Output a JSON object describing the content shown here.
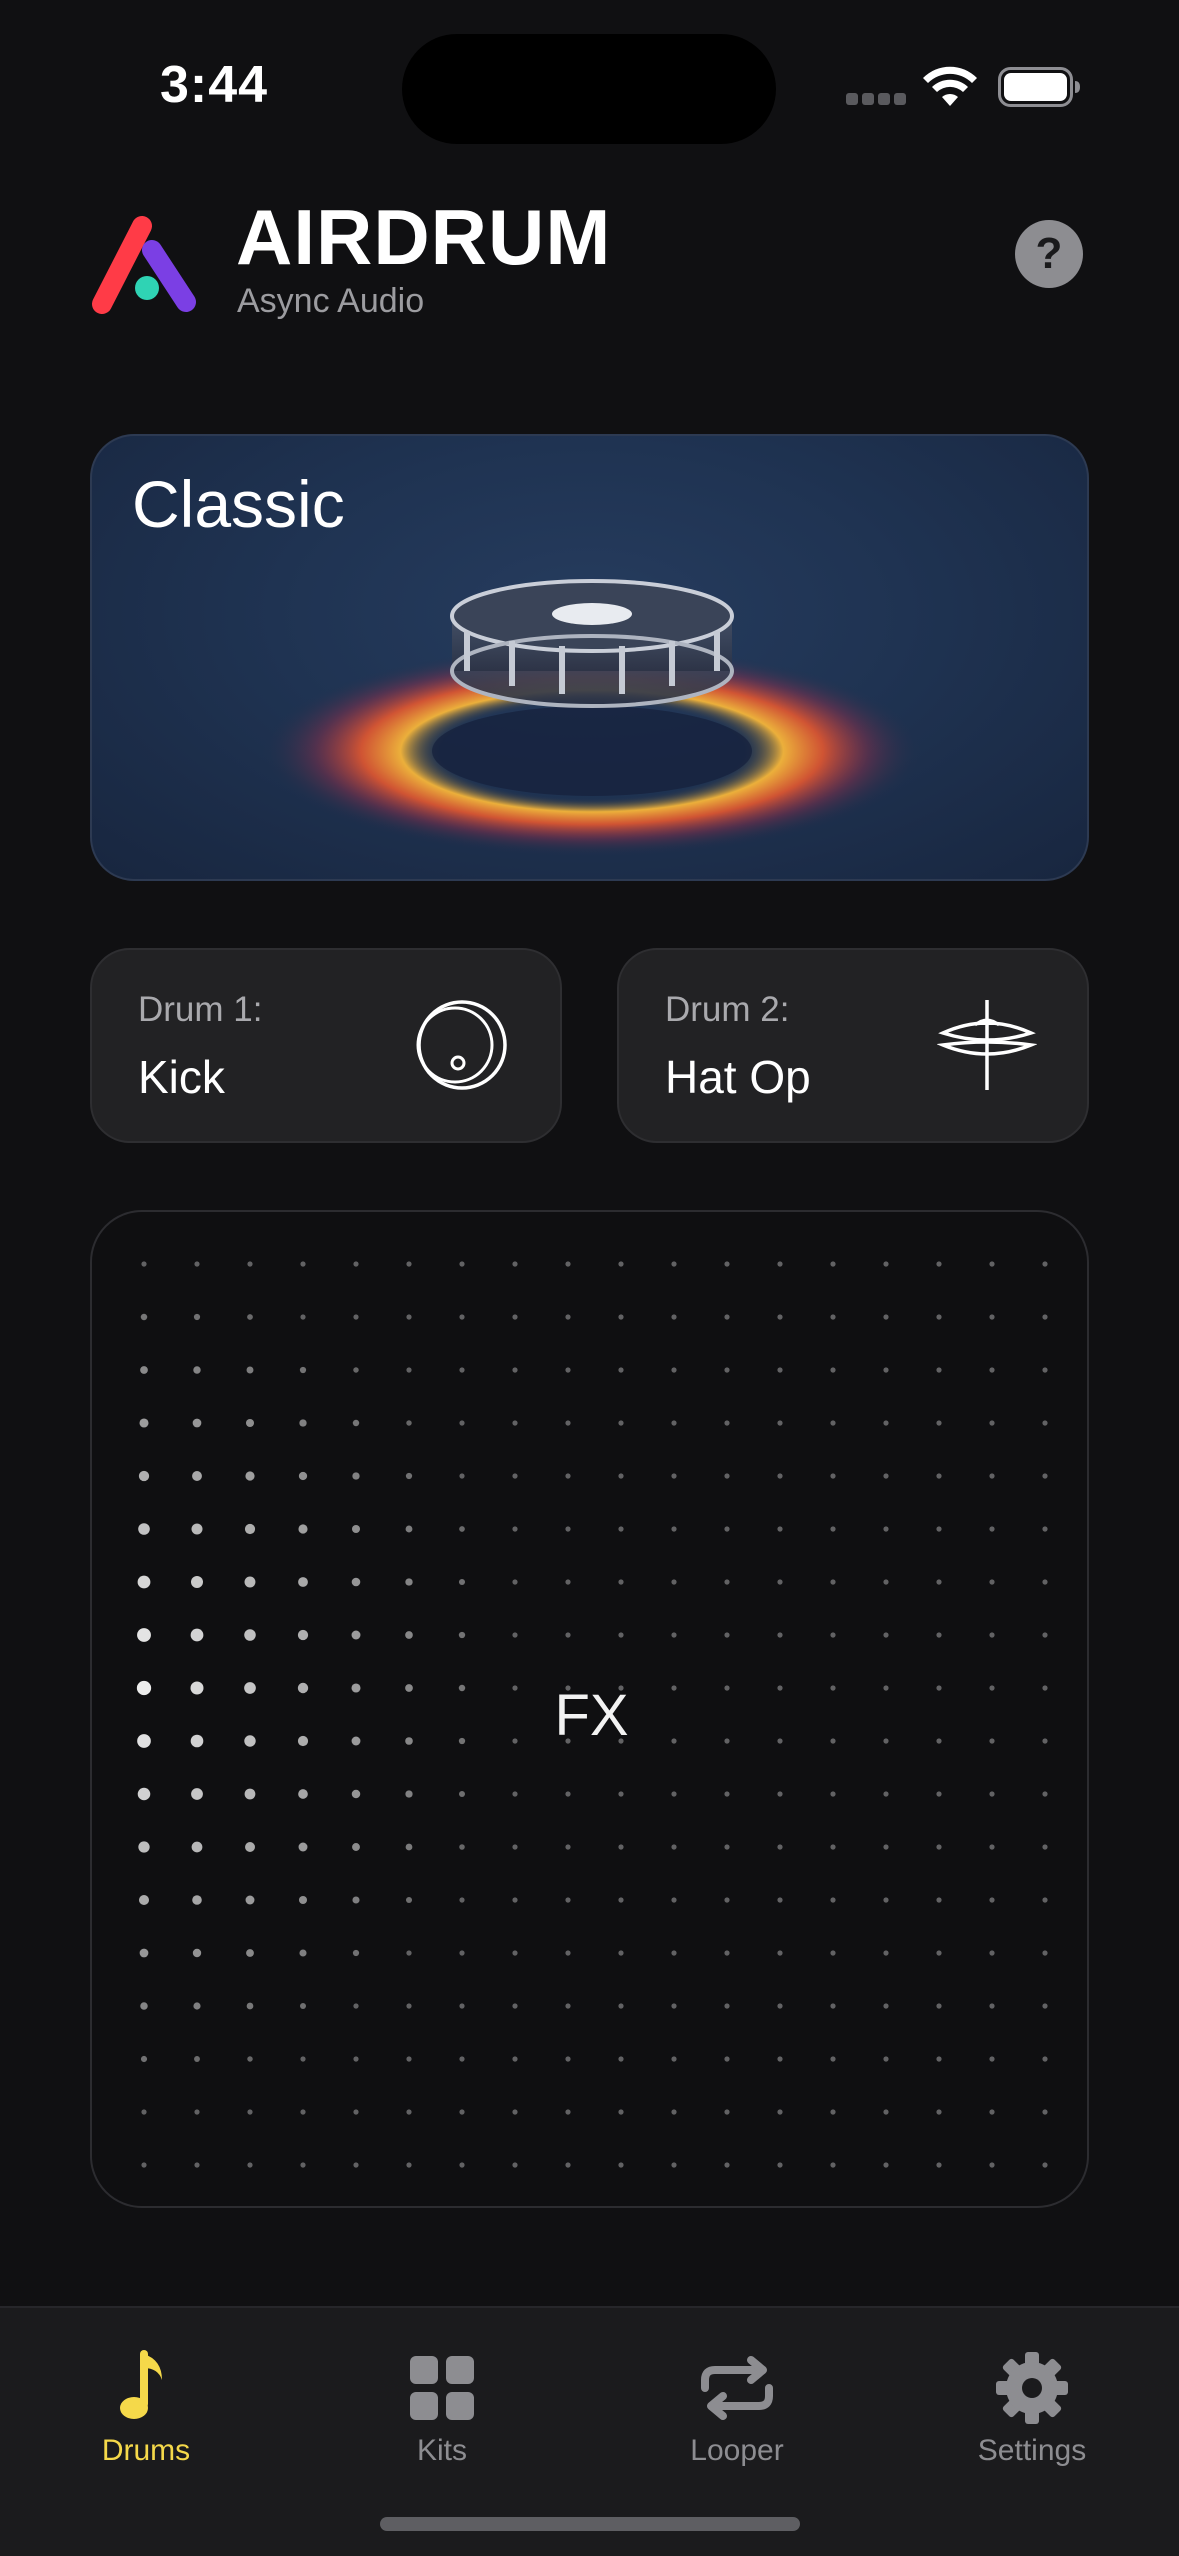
{
  "status_bar": {
    "time": "3:44"
  },
  "header": {
    "brand": "AIRDRUM",
    "subtitle": "Async Audio",
    "help_label": "?"
  },
  "kit": {
    "name": "Classic"
  },
  "drums": [
    {
      "label": "Drum 1:",
      "value": "Kick",
      "icon": "kick-drum-icon"
    },
    {
      "label": "Drum 2:",
      "value": "Hat Op",
      "icon": "hi-hat-icon"
    }
  ],
  "fx_pad": {
    "label": "FX"
  },
  "tabs": [
    {
      "label": "Drums",
      "icon": "music-note-icon",
      "active": true
    },
    {
      "label": "Kits",
      "icon": "grid-icon",
      "active": false
    },
    {
      "label": "Looper",
      "icon": "repeat-icon",
      "active": false
    },
    {
      "label": "Settings",
      "icon": "gear-icon",
      "active": false
    }
  ],
  "colors": {
    "background": "#101012",
    "accent_active": "#f5d94a",
    "tab_inactive": "#8d8d91",
    "card": "#222224",
    "logo_red": "#ff3b47",
    "logo_purple": "#7b3fe4",
    "logo_teal": "#2fd3b4"
  }
}
